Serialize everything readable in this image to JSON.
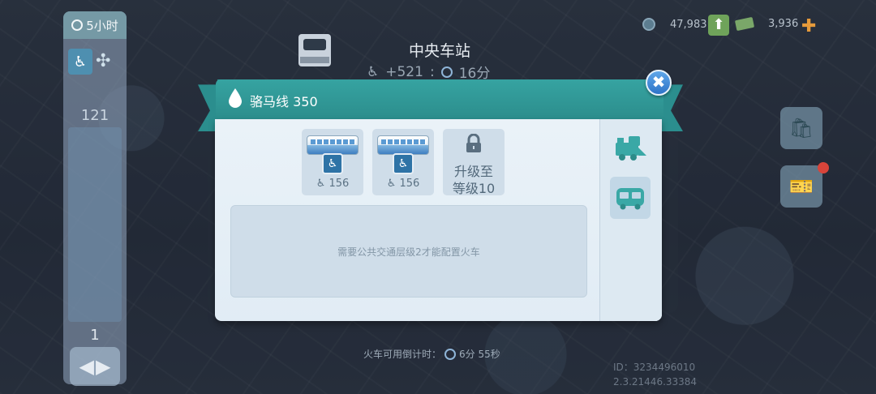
{
  "resources": {
    "simoleons": "47,983",
    "cash": "3,936"
  },
  "left_panel": {
    "timer": "5小时",
    "count": "121",
    "page": "1"
  },
  "station": {
    "title": "中央车站",
    "bonus": "+521",
    "separator": ":",
    "duration": "16分"
  },
  "dialog": {
    "line_name": "骆马线 350",
    "slots": [
      {
        "type": "bus",
        "capacity": "156"
      },
      {
        "type": "bus",
        "capacity": "156"
      },
      {
        "type": "locked",
        "text_line1": "升级至",
        "text_line2": "等级10"
      }
    ],
    "notice": "需要公共交通层级2才能配置火车",
    "tabs": [
      "train",
      "bus"
    ],
    "active_tab": "bus"
  },
  "countdown": {
    "label": "火车可用倒计时：",
    "value": "6分 55秒"
  },
  "version": {
    "id": "ID：3234496010",
    "build": "2.3.21446.33384"
  },
  "colors": {
    "ribbon": "#2b8e8e",
    "panel": "#e6eff6",
    "close_button": "#3f86d6",
    "upgrade_plus": "#e59a3b"
  },
  "icons": [
    "stopwatch-icon",
    "seat-icon",
    "station-icon",
    "simoleon-icon",
    "arrow-up-icon",
    "cash-icon",
    "plus-icon",
    "shop-bag-icon",
    "ticket-icon",
    "water-drop-icon",
    "close-icon",
    "train-icon",
    "bus-icon",
    "lock-icon"
  ]
}
